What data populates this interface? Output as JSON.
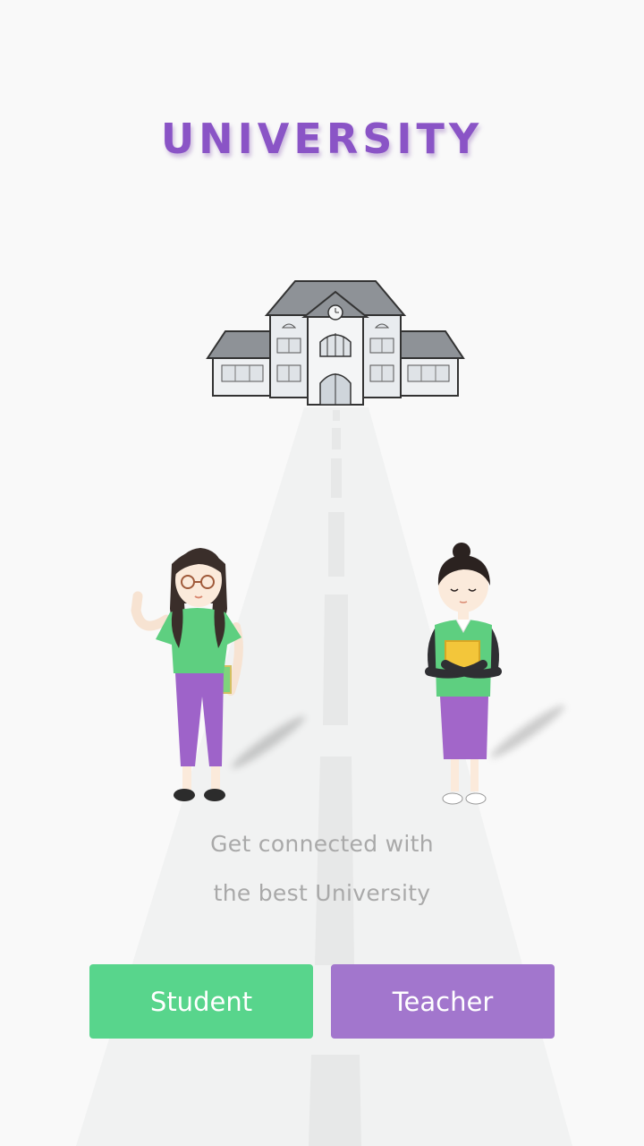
{
  "app": {
    "title": "UNIVERSITY"
  },
  "illustration": {
    "building_icon": "university-building-icon",
    "student_icon": "student-girl-icon",
    "teacher_icon": "teacher-woman-icon"
  },
  "tagline": {
    "line1": "Get connected with",
    "line2": "the best University"
  },
  "buttons": {
    "student_label": "Student",
    "teacher_label": "Teacher"
  },
  "colors": {
    "title": "#8a54c6",
    "student_button": "#58d58c",
    "teacher_button": "#a276cd",
    "tagline_text": "#a9a9a9",
    "background": "#f9f9f9"
  }
}
